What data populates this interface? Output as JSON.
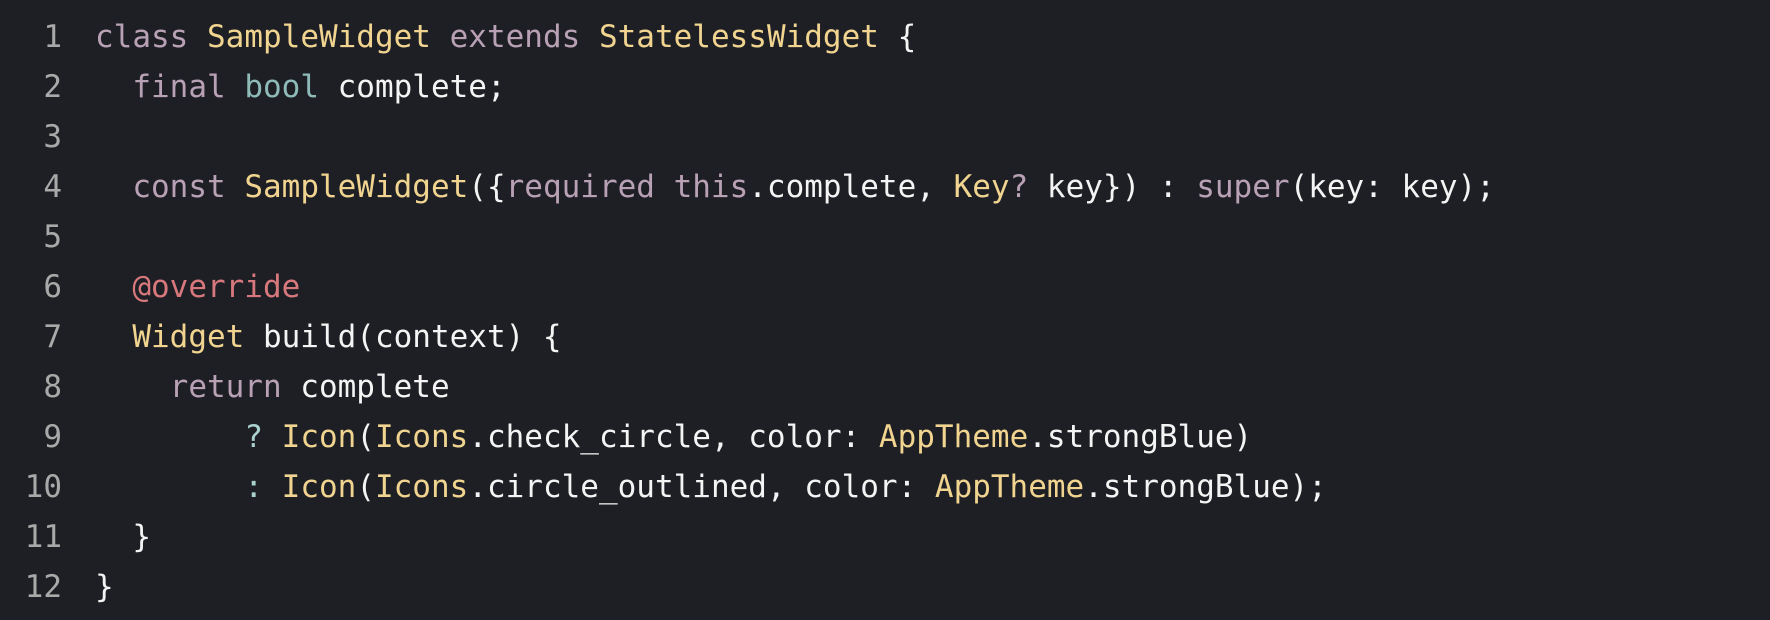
{
  "editor": {
    "background": "#1e1f25",
    "language": "Dart",
    "colors": {
      "line_number": "#a9a9a9",
      "keyword": "#b9a1b5",
      "type": "#f0d48f",
      "builtin_type": "#8ebbb8",
      "annotation": "#d7787c",
      "operator": "#a9d2cf",
      "plain": "#f4f4f4"
    },
    "lines": [
      {
        "number": "1",
        "tokens": [
          {
            "text": "class",
            "kind": "keyword"
          },
          {
            "text": " ",
            "kind": "plain"
          },
          {
            "text": "SampleWidget",
            "kind": "class"
          },
          {
            "text": " ",
            "kind": "plain"
          },
          {
            "text": "extends",
            "kind": "keyword"
          },
          {
            "text": " ",
            "kind": "plain"
          },
          {
            "text": "StatelessWidget",
            "kind": "class"
          },
          {
            "text": " {",
            "kind": "plain"
          }
        ]
      },
      {
        "number": "2",
        "tokens": [
          {
            "text": "  ",
            "kind": "plain"
          },
          {
            "text": "final",
            "kind": "keyword"
          },
          {
            "text": " ",
            "kind": "plain"
          },
          {
            "text": "bool",
            "kind": "builtin"
          },
          {
            "text": " complete;",
            "kind": "plain"
          }
        ]
      },
      {
        "number": "3",
        "tokens": []
      },
      {
        "number": "4",
        "tokens": [
          {
            "text": "  ",
            "kind": "plain"
          },
          {
            "text": "const",
            "kind": "keyword"
          },
          {
            "text": " ",
            "kind": "plain"
          },
          {
            "text": "SampleWidget",
            "kind": "class"
          },
          {
            "text": "({",
            "kind": "plain"
          },
          {
            "text": "required",
            "kind": "keyword"
          },
          {
            "text": " ",
            "kind": "plain"
          },
          {
            "text": "this",
            "kind": "keyword"
          },
          {
            "text": ".complete, ",
            "kind": "plain"
          },
          {
            "text": "Key",
            "kind": "type"
          },
          {
            "text": "?",
            "kind": "keyword"
          },
          {
            "text": " key}) : ",
            "kind": "plain"
          },
          {
            "text": "super",
            "kind": "keyword"
          },
          {
            "text": "(key: key);",
            "kind": "plain"
          }
        ]
      },
      {
        "number": "5",
        "tokens": []
      },
      {
        "number": "6",
        "tokens": [
          {
            "text": "  ",
            "kind": "plain"
          },
          {
            "text": "@override",
            "kind": "annotation"
          }
        ]
      },
      {
        "number": "7",
        "tokens": [
          {
            "text": "  ",
            "kind": "plain"
          },
          {
            "text": "Widget",
            "kind": "type"
          },
          {
            "text": " build(context) {",
            "kind": "plain"
          }
        ]
      },
      {
        "number": "8",
        "tokens": [
          {
            "text": "    ",
            "kind": "plain"
          },
          {
            "text": "return",
            "kind": "keyword"
          },
          {
            "text": " complete",
            "kind": "plain"
          }
        ]
      },
      {
        "number": "9",
        "tokens": [
          {
            "text": "        ",
            "kind": "plain"
          },
          {
            "text": "?",
            "kind": "operator"
          },
          {
            "text": " ",
            "kind": "plain"
          },
          {
            "text": "Icon",
            "kind": "type"
          },
          {
            "text": "(",
            "kind": "plain"
          },
          {
            "text": "Icons",
            "kind": "type"
          },
          {
            "text": ".check_circle, color: ",
            "kind": "plain"
          },
          {
            "text": "AppTheme",
            "kind": "type"
          },
          {
            "text": ".strongBlue)",
            "kind": "plain"
          }
        ]
      },
      {
        "number": "10",
        "tokens": [
          {
            "text": "        ",
            "kind": "plain"
          },
          {
            "text": ":",
            "kind": "operator"
          },
          {
            "text": " ",
            "kind": "plain"
          },
          {
            "text": "Icon",
            "kind": "type"
          },
          {
            "text": "(",
            "kind": "plain"
          },
          {
            "text": "Icons",
            "kind": "type"
          },
          {
            "text": ".circle_outlined, color: ",
            "kind": "plain"
          },
          {
            "text": "AppTheme",
            "kind": "type"
          },
          {
            "text": ".strongBlue);",
            "kind": "plain"
          }
        ]
      },
      {
        "number": "11",
        "tokens": [
          {
            "text": "  }",
            "kind": "plain"
          }
        ]
      },
      {
        "number": "12",
        "tokens": [
          {
            "text": "}",
            "kind": "plain"
          }
        ]
      }
    ]
  }
}
